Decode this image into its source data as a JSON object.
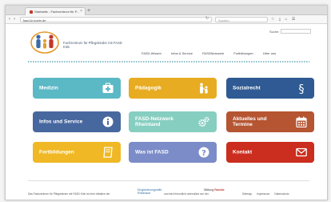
{
  "browser": {
    "tab_title": "Startseite - Fachzentrum für P...",
    "tab_close": "×",
    "new_tab": "+",
    "url": "fasd-fz-koeln.de",
    "search_placeholder": "Suchen",
    "toolbar_icons": "☆ ⤓ ⌂ ☰"
  },
  "site": {
    "logo_title": "Fachzentrum für Pflegekinder mit FASD Köln",
    "search_label": "Suche:",
    "nav": [
      "FASD-Wissen",
      "Infos & Service",
      "FASDNetzwerk",
      "Fortbildungen",
      "Über uns"
    ]
  },
  "tiles": [
    {
      "label": "Medizin",
      "color": "#5bb8c5",
      "icon": "medical-kit-icon"
    },
    {
      "label": "Pädagogik",
      "color": "#e8ac22",
      "icon": "family-icon"
    },
    {
      "label": "Sozialrecht",
      "color": "#2f5a93",
      "icon": "paragraph-icon"
    },
    {
      "label": "Infos und Service",
      "color": "#47679f",
      "icon": "info-icon"
    },
    {
      "label": "FASD-Netzwerk Rheinland",
      "color": "#86cec0",
      "icon": "gears-icon"
    },
    {
      "label": "Aktuelles und Termine",
      "color": "#b55532",
      "icon": "calendar-icon"
    },
    {
      "label": "Fortbildungen",
      "color": "#efb824",
      "icon": "book-icon"
    },
    {
      "label": "Was ist FASD",
      "color": "#7b8cc8",
      "icon": "question-icon"
    },
    {
      "label": "Kontakt",
      "color": "#cb2d1e",
      "icon": "mail-icon"
    }
  ],
  "footer": {
    "text1": "Das Fachzentrum für Pflegekinder mit FASD Köln ist eine Initiative der",
    "logo1": "Eingliederungshilfe Rheinland",
    "text2": "und wird freundlich unterstützt von der",
    "logo2_a": "Stiftung",
    "logo2_b": "Familie",
    "links": [
      "Sitemap",
      "Impressum",
      "Datenschutz"
    ]
  }
}
